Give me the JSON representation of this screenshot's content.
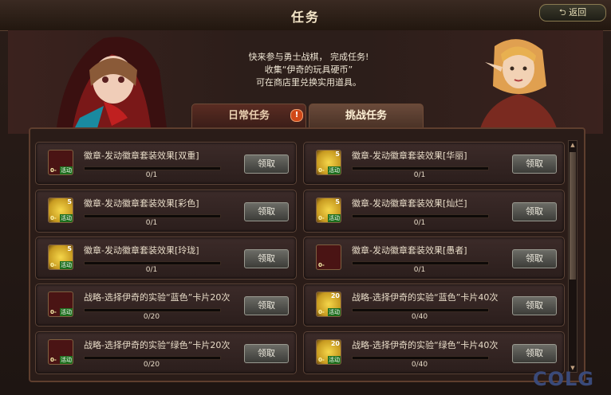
{
  "window": {
    "title": "任务",
    "back_label": "返回"
  },
  "intro": {
    "line1": "快来参与勇士战棋， 完成任务!",
    "line2": "收集“伊奇的玩具硬币”",
    "line3": "可在商店里兑换实用道具。"
  },
  "tabs": [
    {
      "label": "日常任务",
      "alert": "!"
    },
    {
      "label": "挑战任务"
    }
  ],
  "tasks": [
    {
      "name": "徽章-发动徽章套装效果[双重]",
      "progress": "0/1",
      "claim": "领取",
      "icon_type": "red-box",
      "icon_num": "",
      "icon_corner": "0-",
      "icon_tag": "活动"
    },
    {
      "name": "徽章-发动徽章套装效果[华丽]",
      "progress": "0/1",
      "claim": "领取",
      "icon_type": "gold-coin",
      "icon_num": "5",
      "icon_corner": "0-",
      "icon_tag": "活动"
    },
    {
      "name": "徽章-发动徽章套装效果[彩色]",
      "progress": "0/1",
      "claim": "领取",
      "icon_type": "gold-coin",
      "icon_num": "5",
      "icon_corner": "0-",
      "icon_tag": "活动"
    },
    {
      "name": "徽章-发动徽章套装效果[灿烂]",
      "progress": "0/1",
      "claim": "领取",
      "icon_type": "gold-coin",
      "icon_num": "5",
      "icon_corner": "0-",
      "icon_tag": "活动"
    },
    {
      "name": "徽章-发动徽章套装效果[玲珑]",
      "progress": "0/1",
      "claim": "领取",
      "icon_type": "gold-coin",
      "icon_num": "5",
      "icon_corner": "0-",
      "icon_tag": "活动"
    },
    {
      "name": "徽章-发动徽章套装效果[愚者]",
      "progress": "0/1",
      "claim": "领取",
      "icon_type": "red-box",
      "icon_num": "",
      "icon_corner": "0-",
      "icon_tag": ""
    },
    {
      "name": "战略-选择伊奇的实验“蓝色”卡片20次",
      "progress": "0/20",
      "claim": "领取",
      "icon_type": "red-box",
      "icon_num": "",
      "icon_corner": "0-",
      "icon_tag": "活动"
    },
    {
      "name": "战略-选择伊奇的实验“蓝色”卡片40次",
      "progress": "0/40",
      "claim": "领取",
      "icon_type": "gold-coin",
      "icon_num": "20",
      "icon_corner": "0-",
      "icon_tag": "活动"
    },
    {
      "name": "战略-选择伊奇的实验“绿色”卡片20次",
      "progress": "0/20",
      "claim": "领取",
      "icon_type": "red-box",
      "icon_num": "",
      "icon_corner": "0-",
      "icon_tag": "活动"
    },
    {
      "name": "战略-选择伊奇的实验“绿色”卡片40次",
      "progress": "0/40",
      "claim": "领取",
      "icon_type": "gold-coin",
      "icon_num": "20",
      "icon_corner": "0-",
      "icon_tag": "活动"
    }
  ],
  "watermark": "COLG",
  "colors": {
    "accent": "#d04818",
    "panel": "#2a1c18",
    "claim_button": "#6c6c66"
  }
}
